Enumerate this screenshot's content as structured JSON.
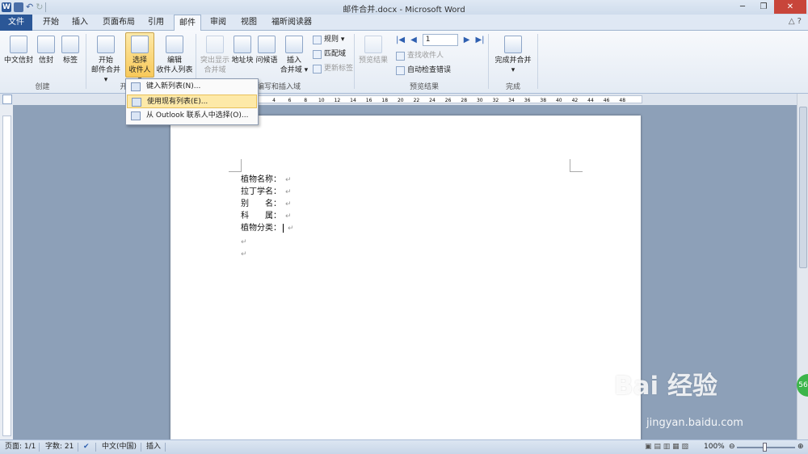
{
  "window": {
    "title": "邮件合并.docx - Microsoft Word"
  },
  "tabs": [
    "文件",
    "开始",
    "插入",
    "页面布局",
    "引用",
    "邮件",
    "审阅",
    "视图",
    "福昕阅读器"
  ],
  "ribbon": {
    "create": {
      "btn1": "中文信封",
      "btn2": "信封",
      "btn3": "标签",
      "label": "创建"
    },
    "start": {
      "btn1_l1": "开始",
      "btn1_l2": "邮件合并 ▾",
      "btn2_l1": "选择",
      "btn2_l2": "收件人 ▾",
      "btn3_l1": "编辑",
      "btn3_l2": "收件人列表",
      "label": "开"
    },
    "write": {
      "btn1_l1": "突出显示",
      "btn1_l2": "合并域",
      "btn2": "地址块",
      "btn3": "问候语",
      "btn4_l1": "插入",
      "btn4_l2": "合并域 ▾",
      "rules": "规则 ▾",
      "match": "匹配域",
      "update": "更新标签",
      "label": "编写和插入域"
    },
    "preview": {
      "btn1": "预览结果",
      "record": "1",
      "find": "查找收件人",
      "autocheck": "自动检查错误",
      "label": "预览结果"
    },
    "finish": {
      "btn1": "完成并合并",
      "label": "完成"
    }
  },
  "dropdown": {
    "item1": "键入新列表(N)...",
    "item2": "使用现有列表(E)...",
    "item3": "从 Outlook 联系人中选择(O)..."
  },
  "ruler": {
    "ticks": [
      "4",
      "6",
      "8",
      "10",
      "12",
      "14",
      "16",
      "18",
      "20",
      "22",
      "24",
      "26",
      "28",
      "30",
      "32",
      "34",
      "36",
      "38",
      "40",
      "42",
      "44",
      "46",
      "48"
    ]
  },
  "document": {
    "lines": [
      "植物名称：",
      "拉丁学名：",
      "别　　名：",
      "科　　属：",
      "植物分类："
    ]
  },
  "status": {
    "page": "页面: 1/1",
    "words": "字数: 21",
    "lang": "中文(中国)",
    "mode": "插入",
    "zoom": "100%"
  },
  "watermark": {
    "line1": "Bai 经验",
    "line2": "jingyan.baidu.com",
    "badge": "56"
  }
}
